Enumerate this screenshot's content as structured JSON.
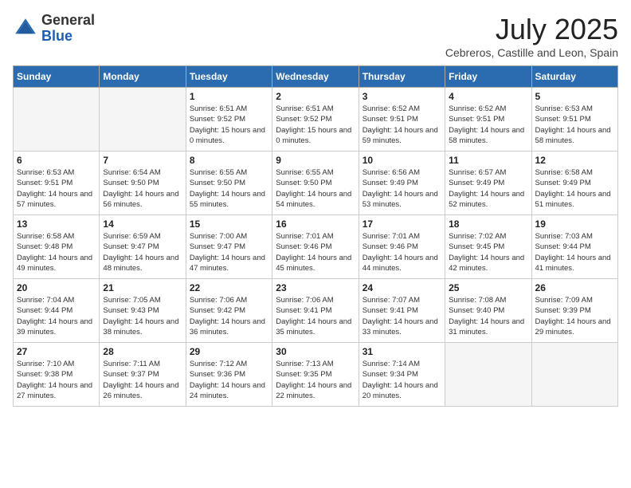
{
  "header": {
    "logo_general": "General",
    "logo_blue": "Blue",
    "month_title": "July 2025",
    "location": "Cebreros, Castille and Leon, Spain"
  },
  "weekdays": [
    "Sunday",
    "Monday",
    "Tuesday",
    "Wednesday",
    "Thursday",
    "Friday",
    "Saturday"
  ],
  "weeks": [
    [
      {
        "day": "",
        "empty": true
      },
      {
        "day": "",
        "empty": true
      },
      {
        "day": "1",
        "sunrise": "Sunrise: 6:51 AM",
        "sunset": "Sunset: 9:52 PM",
        "daylight": "Daylight: 15 hours and 0 minutes."
      },
      {
        "day": "2",
        "sunrise": "Sunrise: 6:51 AM",
        "sunset": "Sunset: 9:52 PM",
        "daylight": "Daylight: 15 hours and 0 minutes."
      },
      {
        "day": "3",
        "sunrise": "Sunrise: 6:52 AM",
        "sunset": "Sunset: 9:51 PM",
        "daylight": "Daylight: 14 hours and 59 minutes."
      },
      {
        "day": "4",
        "sunrise": "Sunrise: 6:52 AM",
        "sunset": "Sunset: 9:51 PM",
        "daylight": "Daylight: 14 hours and 58 minutes."
      },
      {
        "day": "5",
        "sunrise": "Sunrise: 6:53 AM",
        "sunset": "Sunset: 9:51 PM",
        "daylight": "Daylight: 14 hours and 58 minutes."
      }
    ],
    [
      {
        "day": "6",
        "sunrise": "Sunrise: 6:53 AM",
        "sunset": "Sunset: 9:51 PM",
        "daylight": "Daylight: 14 hours and 57 minutes."
      },
      {
        "day": "7",
        "sunrise": "Sunrise: 6:54 AM",
        "sunset": "Sunset: 9:50 PM",
        "daylight": "Daylight: 14 hours and 56 minutes."
      },
      {
        "day": "8",
        "sunrise": "Sunrise: 6:55 AM",
        "sunset": "Sunset: 9:50 PM",
        "daylight": "Daylight: 14 hours and 55 minutes."
      },
      {
        "day": "9",
        "sunrise": "Sunrise: 6:55 AM",
        "sunset": "Sunset: 9:50 PM",
        "daylight": "Daylight: 14 hours and 54 minutes."
      },
      {
        "day": "10",
        "sunrise": "Sunrise: 6:56 AM",
        "sunset": "Sunset: 9:49 PM",
        "daylight": "Daylight: 14 hours and 53 minutes."
      },
      {
        "day": "11",
        "sunrise": "Sunrise: 6:57 AM",
        "sunset": "Sunset: 9:49 PM",
        "daylight": "Daylight: 14 hours and 52 minutes."
      },
      {
        "day": "12",
        "sunrise": "Sunrise: 6:58 AM",
        "sunset": "Sunset: 9:49 PM",
        "daylight": "Daylight: 14 hours and 51 minutes."
      }
    ],
    [
      {
        "day": "13",
        "sunrise": "Sunrise: 6:58 AM",
        "sunset": "Sunset: 9:48 PM",
        "daylight": "Daylight: 14 hours and 49 minutes."
      },
      {
        "day": "14",
        "sunrise": "Sunrise: 6:59 AM",
        "sunset": "Sunset: 9:47 PM",
        "daylight": "Daylight: 14 hours and 48 minutes."
      },
      {
        "day": "15",
        "sunrise": "Sunrise: 7:00 AM",
        "sunset": "Sunset: 9:47 PM",
        "daylight": "Daylight: 14 hours and 47 minutes."
      },
      {
        "day": "16",
        "sunrise": "Sunrise: 7:01 AM",
        "sunset": "Sunset: 9:46 PM",
        "daylight": "Daylight: 14 hours and 45 minutes."
      },
      {
        "day": "17",
        "sunrise": "Sunrise: 7:01 AM",
        "sunset": "Sunset: 9:46 PM",
        "daylight": "Daylight: 14 hours and 44 minutes."
      },
      {
        "day": "18",
        "sunrise": "Sunrise: 7:02 AM",
        "sunset": "Sunset: 9:45 PM",
        "daylight": "Daylight: 14 hours and 42 minutes."
      },
      {
        "day": "19",
        "sunrise": "Sunrise: 7:03 AM",
        "sunset": "Sunset: 9:44 PM",
        "daylight": "Daylight: 14 hours and 41 minutes."
      }
    ],
    [
      {
        "day": "20",
        "sunrise": "Sunrise: 7:04 AM",
        "sunset": "Sunset: 9:44 PM",
        "daylight": "Daylight: 14 hours and 39 minutes."
      },
      {
        "day": "21",
        "sunrise": "Sunrise: 7:05 AM",
        "sunset": "Sunset: 9:43 PM",
        "daylight": "Daylight: 14 hours and 38 minutes."
      },
      {
        "day": "22",
        "sunrise": "Sunrise: 7:06 AM",
        "sunset": "Sunset: 9:42 PM",
        "daylight": "Daylight: 14 hours and 36 minutes."
      },
      {
        "day": "23",
        "sunrise": "Sunrise: 7:06 AM",
        "sunset": "Sunset: 9:41 PM",
        "daylight": "Daylight: 14 hours and 35 minutes."
      },
      {
        "day": "24",
        "sunrise": "Sunrise: 7:07 AM",
        "sunset": "Sunset: 9:41 PM",
        "daylight": "Daylight: 14 hours and 33 minutes."
      },
      {
        "day": "25",
        "sunrise": "Sunrise: 7:08 AM",
        "sunset": "Sunset: 9:40 PM",
        "daylight": "Daylight: 14 hours and 31 minutes."
      },
      {
        "day": "26",
        "sunrise": "Sunrise: 7:09 AM",
        "sunset": "Sunset: 9:39 PM",
        "daylight": "Daylight: 14 hours and 29 minutes."
      }
    ],
    [
      {
        "day": "27",
        "sunrise": "Sunrise: 7:10 AM",
        "sunset": "Sunset: 9:38 PM",
        "daylight": "Daylight: 14 hours and 27 minutes."
      },
      {
        "day": "28",
        "sunrise": "Sunrise: 7:11 AM",
        "sunset": "Sunset: 9:37 PM",
        "daylight": "Daylight: 14 hours and 26 minutes."
      },
      {
        "day": "29",
        "sunrise": "Sunrise: 7:12 AM",
        "sunset": "Sunset: 9:36 PM",
        "daylight": "Daylight: 14 hours and 24 minutes."
      },
      {
        "day": "30",
        "sunrise": "Sunrise: 7:13 AM",
        "sunset": "Sunset: 9:35 PM",
        "daylight": "Daylight: 14 hours and 22 minutes."
      },
      {
        "day": "31",
        "sunrise": "Sunrise: 7:14 AM",
        "sunset": "Sunset: 9:34 PM",
        "daylight": "Daylight: 14 hours and 20 minutes."
      },
      {
        "day": "",
        "empty": true
      },
      {
        "day": "",
        "empty": true
      }
    ]
  ]
}
